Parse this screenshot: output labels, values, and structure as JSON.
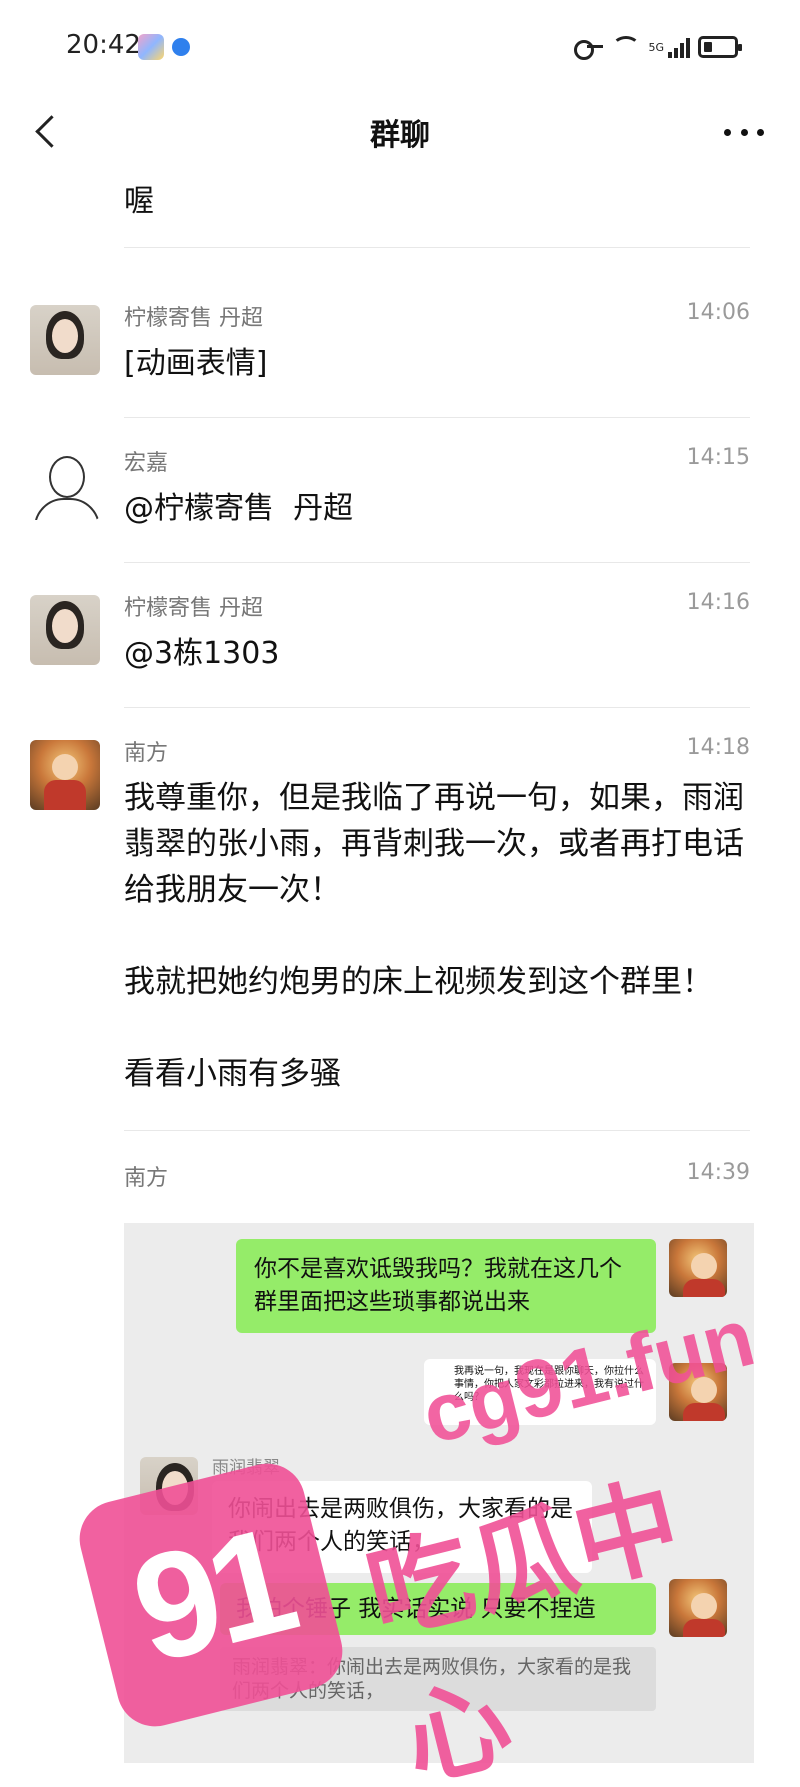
{
  "status_bar": {
    "time": "20:42",
    "network": "5G",
    "icons": [
      "key-icon",
      "wifi-icon",
      "signal-icon",
      "battery-icon"
    ]
  },
  "nav": {
    "title": "群聊"
  },
  "messages": [
    {
      "sender": "",
      "time": "",
      "text": "喔"
    },
    {
      "sender": "柠檬寄售  丹超",
      "time": "14:06",
      "text": "[动画表情]",
      "avatar": "woman-photo"
    },
    {
      "sender": "宏嘉",
      "time": "14:15",
      "text": "@柠檬寄售  丹超",
      "avatar": "sketch"
    },
    {
      "sender": "柠檬寄售  丹超",
      "time": "14:16",
      "text": "@3栋1303",
      "avatar": "woman-photo"
    },
    {
      "sender": "南方",
      "time": "14:18",
      "text": "我尊重你，但是我临了再说一句，如果，雨润翡翠的张小雨，再背刺我一次，或者再打电话给我朋友一次！\n\n我就把她约炮男的床上视频发到这个群里！\n\n看看小雨有多骚",
      "avatar": "cartoon"
    },
    {
      "sender": "南方",
      "time": "14:39",
      "text": ""
    }
  ],
  "embedded_chat": {
    "bubble1": "你不是喜欢诋毁我吗？我就在这几个群里面把这些琐事都说出来",
    "small_bubble": "我再说一句，我现在是跟你聊天，你拉什么事情，你把人家文彩都拉进来，我有说过什么吗？",
    "sender_name": "雨润翡翠",
    "bubble2": "你闹出去是两败俱伤，大家看的是我们两个人的笑话，",
    "bubble3": "我怕个锤子 我实话实说 只要不捏造",
    "quote": "雨润翡翠：你闹出去是两败俱伤，大家看的是我们两个人的笑话，"
  },
  "watermark": {
    "logo": "91",
    "url": "cg91.fun",
    "slogan": "吃瓜中心",
    "color": "#f05096"
  }
}
